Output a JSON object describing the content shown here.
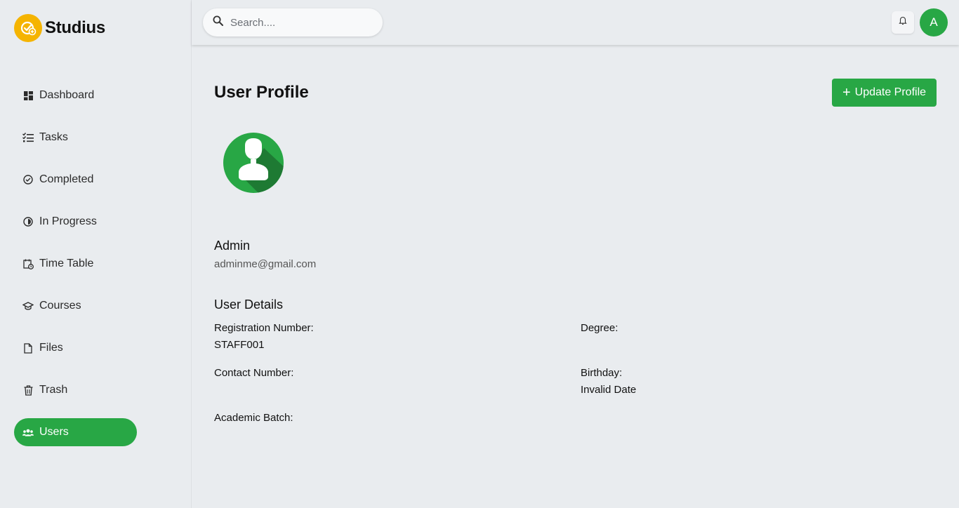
{
  "app": {
    "name": "Studius"
  },
  "search": {
    "placeholder": "Search...."
  },
  "header": {
    "avatar_initial": "A"
  },
  "sidebar": {
    "items": [
      {
        "label": "Dashboard",
        "icon": "dashboard-icon",
        "active": false
      },
      {
        "label": "Tasks",
        "icon": "tasks-icon",
        "active": false
      },
      {
        "label": "Completed",
        "icon": "check-circle-icon",
        "active": false
      },
      {
        "label": "In Progress",
        "icon": "half-circle-icon",
        "active": false
      },
      {
        "label": "Time Table",
        "icon": "calendar-clock-icon",
        "active": false
      },
      {
        "label": "Courses",
        "icon": "graduation-cap-icon",
        "active": false
      },
      {
        "label": "Files",
        "icon": "file-icon",
        "active": false
      },
      {
        "label": "Trash",
        "icon": "trash-icon",
        "active": false
      },
      {
        "label": "Users",
        "icon": "users-icon",
        "active": true
      }
    ]
  },
  "main": {
    "title": "User Profile",
    "update_button": "Update Profile",
    "user": {
      "name": "Admin",
      "email": "adminme@gmail.com"
    },
    "details_title": "User Details",
    "details": {
      "registration_label": "Registration Number:",
      "registration_value": "STAFF001",
      "degree_label": "Degree:",
      "degree_value": "",
      "contact_label": "Contact Number:",
      "contact_value": "",
      "birthday_label": "Birthday:",
      "birthday_value": "Invalid Date",
      "batch_label": "Academic Batch:",
      "batch_value": ""
    }
  },
  "colors": {
    "accent": "#28a745",
    "logo": "#f5b400",
    "background": "#e9ecef"
  }
}
